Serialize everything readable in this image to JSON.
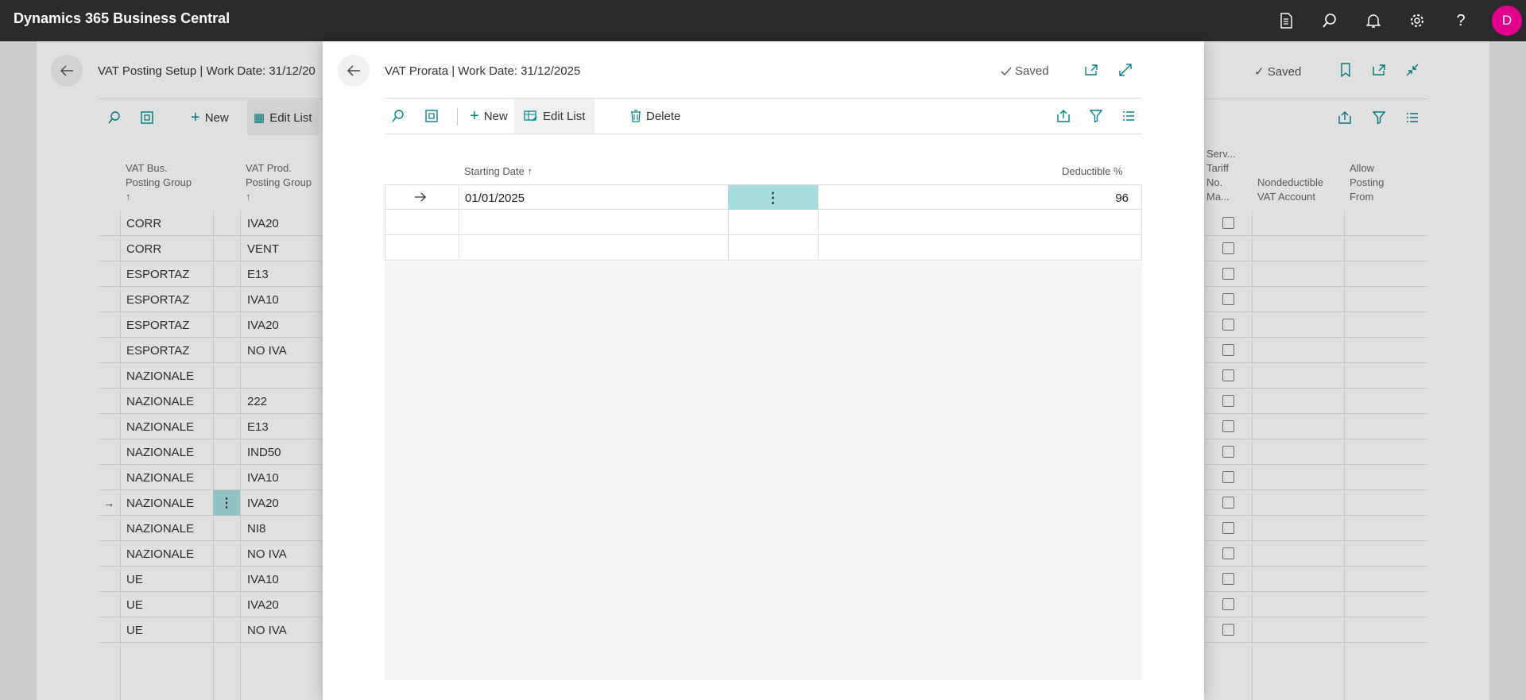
{
  "app": {
    "title": "Dynamics 365 Business Central",
    "avatar_initial": "D"
  },
  "topbar_icons": [
    "document-icon",
    "search-icon",
    "bell-icon",
    "gear-icon",
    "help-icon"
  ],
  "background_page": {
    "title": "VAT Posting Setup | Work Date: 31/12/20",
    "saved_label": "Saved",
    "toolbar": {
      "new_label": "New",
      "edit_list_label": "Edit List"
    },
    "columns": {
      "bus_group": [
        "VAT Bus.",
        "Posting Group",
        "↑"
      ],
      "prod_group": [
        "VAT Prod.",
        "Posting Group",
        "↑"
      ],
      "serv_tariff": [
        "Serv...",
        "Tariff",
        "No.",
        "Ma..."
      ],
      "nondeductible": [
        "Nondeductible",
        "VAT Account"
      ],
      "allow_posting": [
        "Allow",
        "Posting",
        "From"
      ]
    },
    "rows": [
      {
        "bus": "CORR",
        "prod": "IVA20"
      },
      {
        "bus": "CORR",
        "prod": "VENT"
      },
      {
        "bus": "ESPORTAZ",
        "prod": "E13"
      },
      {
        "bus": "ESPORTAZ",
        "prod": "IVA10"
      },
      {
        "bus": "ESPORTAZ",
        "prod": "IVA20"
      },
      {
        "bus": "ESPORTAZ",
        "prod": "NO IVA"
      },
      {
        "bus": "NAZIONALE",
        "prod": ""
      },
      {
        "bus": "NAZIONALE",
        "prod": "222"
      },
      {
        "bus": "NAZIONALE",
        "prod": "E13"
      },
      {
        "bus": "NAZIONALE",
        "prod": "IND50"
      },
      {
        "bus": "NAZIONALE",
        "prod": "IVA10"
      },
      {
        "bus": "NAZIONALE",
        "prod": "IVA20",
        "selected": true
      },
      {
        "bus": "NAZIONALE",
        "prod": "NI8"
      },
      {
        "bus": "NAZIONALE",
        "prod": "NO IVA"
      },
      {
        "bus": "UE",
        "prod": "IVA10"
      },
      {
        "bus": "UE",
        "prod": "IVA20"
      },
      {
        "bus": "UE",
        "prod": "NO IVA"
      }
    ]
  },
  "dialog": {
    "title": "VAT Prorata | Work Date: 31/12/2025",
    "saved_label": "Saved",
    "toolbar": {
      "new_label": "New",
      "edit_list_label": "Edit List",
      "delete_label": "Delete"
    },
    "columns": {
      "starting_date": "Starting Date ↑",
      "deductible": "Deductible %"
    },
    "rows": [
      {
        "starting_date": "01/01/2025",
        "deductible": "96"
      }
    ]
  },
  "colors": {
    "accent": "#008489",
    "selection": "#a8dde0",
    "topbar": "#2b2b2b",
    "avatar": "#e3008c"
  }
}
